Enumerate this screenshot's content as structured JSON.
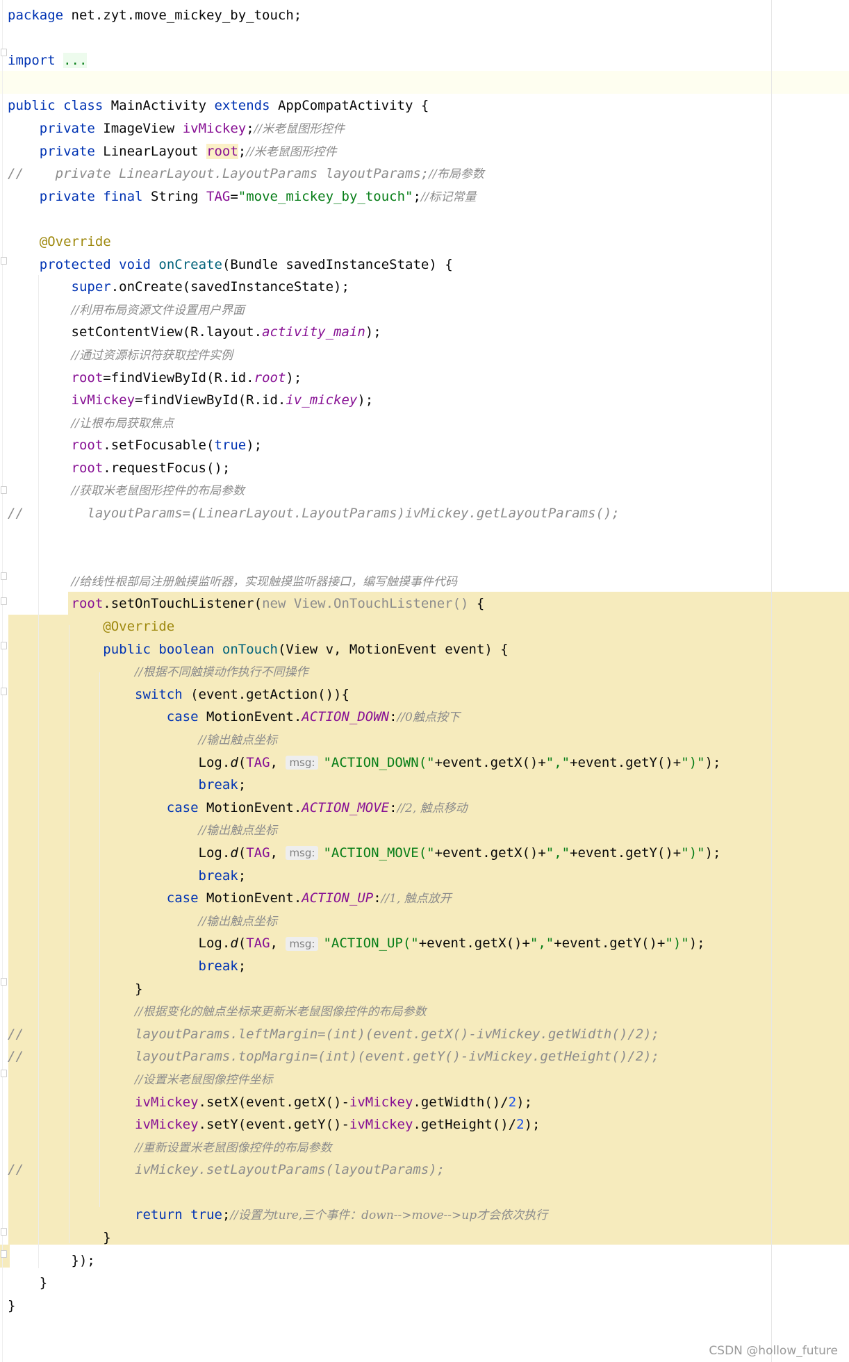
{
  "code": {
    "line1": {
      "kw": "package",
      "text": " net.zyt.move_mickey_by_touch;"
    },
    "line3": {
      "kw": "import",
      "fold": "..."
    },
    "line5": {
      "kw1": "public",
      "kw2": "class",
      "name": " MainActivity ",
      "kw3": "extends",
      "rest": " AppCompatActivity {"
    },
    "line6": {
      "kw": "private",
      "type": " ImageView ",
      "field": "ivMickey",
      "semi": ";",
      "comment": "//米老鼠图形控件"
    },
    "line7": {
      "kw": "private",
      "type": " LinearLayout ",
      "field": "root",
      "semi": ";",
      "comment": "//米老鼠图形控件"
    },
    "line8": {
      "prefix": "//",
      "text": "    private LinearLayout.LayoutParams layoutParams;",
      "comment": "//布局参数"
    },
    "line9": {
      "kw1": "private",
      "kw2": "final",
      "type": " String ",
      "field": "TAG",
      "eq": "=",
      "str": "\"move_mickey_by_touch\"",
      "semi": ";",
      "comment": "//标记常量"
    },
    "line11": {
      "ann": "@Override"
    },
    "line12": {
      "kw1": "protected",
      "kw2": "void",
      "fn": "onCreate",
      "rest": "(Bundle savedInstanceState) {"
    },
    "line13": {
      "kw": "super",
      "rest": ".onCreate(savedInstanceState);"
    },
    "line14": {
      "comment": "//利用布局资源文件设置用户界面"
    },
    "line15": {
      "pre": "setContentView(R.layout.",
      "stat": "activity_main",
      "post": ");"
    },
    "line16": {
      "comment": "//通过资源标识符获取控件实例"
    },
    "line17": {
      "field": "root",
      "pre": "=findViewById(R.id.",
      "stat": "root",
      "post": ");"
    },
    "line18": {
      "field": "ivMickey",
      "pre": "=findViewById(R.id.",
      "stat": "iv_mickey",
      "post": ");"
    },
    "line19": {
      "comment": "//让根布局获取焦点"
    },
    "line20": {
      "field": "root",
      "pre": ".setFocusable(",
      "kw": "true",
      "post": ");"
    },
    "line21": {
      "field": "root",
      "rest": ".requestFocus();"
    },
    "line22": {
      "comment": "//获取米老鼠图形控件的布局参数"
    },
    "line23": {
      "prefix": "//",
      "text": "        layoutParams=(LinearLayout.LayoutParams)ivMickey.getLayoutParams();"
    },
    "line26": {
      "comment": "//给线性根部局注册触摸监听器，实现触摸监听器接口，编写触摸事件代码"
    },
    "line27": {
      "field": "root",
      "pre": ".setOnTouchListener(",
      "gray": "new View.OnTouchListener()",
      "post": " {"
    },
    "line28": {
      "ann": "@Override"
    },
    "line29": {
      "kw1": "public",
      "kw2": "boolean",
      "fn": "onTouch",
      "rest": "(View v, MotionEvent event) {"
    },
    "line30": {
      "comment": "//根据不同触摸动作执行不同操作"
    },
    "line31": {
      "kw": "switch",
      "rest": " (event.getAction()){"
    },
    "line32": {
      "kw": "case",
      "type": " MotionEvent.",
      "stat": "ACTION_DOWN",
      "colon": ":",
      "comment": "//0触点按下"
    },
    "line33": {
      "comment": "//输出触点坐标"
    },
    "line34": {
      "pre": "Log.",
      "fnI": "d",
      "paren": "(",
      "field": "TAG",
      "comma": ", ",
      "hint": "msg:",
      "s1": "\"ACTION_DOWN(\"",
      "m1": "+event.getX()+",
      "s2": "\",\"",
      "m2": "+event.getY()+",
      "s3": "\")\"",
      "post": ");"
    },
    "line35": {
      "kw": "break",
      "semi": ";"
    },
    "line36": {
      "kw": "case",
      "type": " MotionEvent.",
      "stat": "ACTION_MOVE",
      "colon": ":",
      "comment": "//2, 触点移动"
    },
    "line37": {
      "comment": "//输出触点坐标"
    },
    "line38": {
      "pre": "Log.",
      "fnI": "d",
      "paren": "(",
      "field": "TAG",
      "comma": ", ",
      "hint": "msg:",
      "s1": "\"ACTION_MOVE(\"",
      "m1": "+event.getX()+",
      "s2": "\",\"",
      "m2": "+event.getY()+",
      "s3": "\")\"",
      "post": ");"
    },
    "line39": {
      "kw": "break",
      "semi": ";"
    },
    "line40": {
      "kw": "case",
      "type": " MotionEvent.",
      "stat": "ACTION_UP",
      "colon": ":",
      "comment": "//1, 触点放开"
    },
    "line41": {
      "comment": "//输出触点坐标"
    },
    "line42": {
      "pre": "Log.",
      "fnI": "d",
      "paren": "(",
      "field": "TAG",
      "comma": ", ",
      "hint": "msg:",
      "s1": "\"ACTION_UP(\"",
      "m1": "+event.getX()+",
      "s2": "\",\"",
      "m2": "+event.getY()+",
      "s3": "\")\"",
      "post": ");"
    },
    "line43": {
      "kw": "break",
      "semi": ";"
    },
    "line44": {
      "text": "}"
    },
    "line45": {
      "comment": "//根据变化的触点坐标来更新米老鼠图像控件的布局参数"
    },
    "line46": {
      "prefix": "//",
      "text": "              layoutParams.leftMargin=(int)(event.getX()-ivMickey.getWidth()/2);"
    },
    "line47": {
      "prefix": "//",
      "text": "              layoutParams.topMargin=(int)(event.getY()-ivMickey.getHeight()/2);"
    },
    "line48": {
      "comment": "//设置米老鼠图像控件坐标"
    },
    "line49": {
      "field": "ivMickey",
      "pre": ".setX(event.getX()-",
      "field2": "ivMickey",
      "mid": ".getWidth()/",
      "num": "2",
      "post": ");"
    },
    "line50": {
      "field": "ivMickey",
      "pre": ".setY(event.getY()-",
      "field2": "ivMickey",
      "mid": ".getHeight()/",
      "num": "2",
      "post": ");"
    },
    "line51": {
      "comment": "//重新设置米老鼠图像控件的布局参数"
    },
    "line52": {
      "prefix": "//",
      "text": "              ivMickey.setLayoutParams(layoutParams);"
    },
    "line54": {
      "kw1": "return",
      "kw2": "true",
      "semi": ";",
      "comment": "//设置为ture,三个事件：down-->move-->up才会依次执行"
    },
    "line55": {
      "text": "}"
    },
    "line56": {
      "text": "});"
    },
    "line57": {
      "text": "}"
    },
    "line58": {
      "text": "}"
    }
  },
  "watermark": "CSDN @hollow_future",
  "colors": {
    "keyword": "#0033b3",
    "string": "#067d17",
    "field": "#871094",
    "comment": "#8c8c8c",
    "annotation": "#9e880d",
    "function": "#00627a",
    "number": "#1750eb",
    "lambda_highlight": "#f6ebbd"
  }
}
